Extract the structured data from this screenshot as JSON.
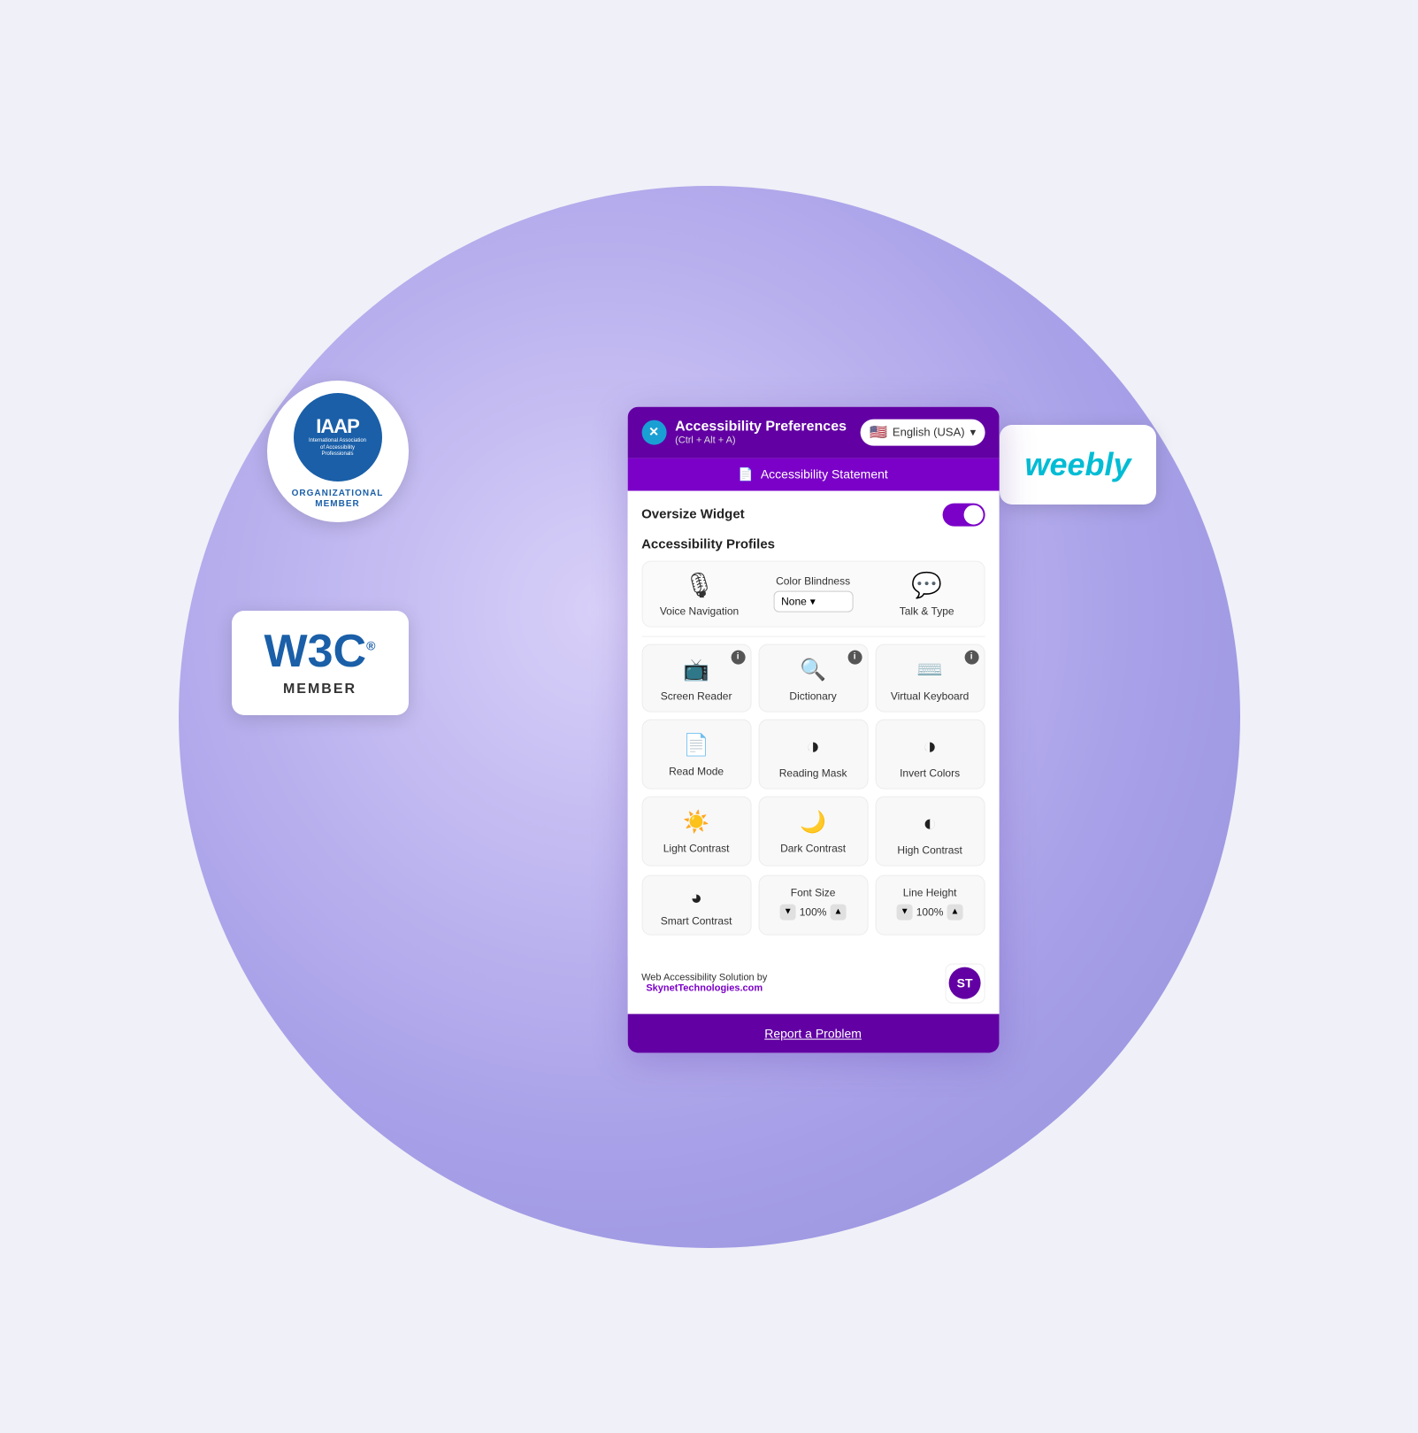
{
  "circle": {
    "visible": true
  },
  "iaap": {
    "title": "IAAP",
    "subtitle": "International Association of Accessibility Professionals",
    "org_member": "ORGANIZATIONAL\nMEMBER"
  },
  "w3c": {
    "title": "W3C",
    "member": "MEMBER"
  },
  "weebly": {
    "text": "weebly"
  },
  "header": {
    "close_label": "✕",
    "title": "Accessibility Preferences",
    "subtitle": "(Ctrl + Alt + A)",
    "lang_label": "English (USA)",
    "lang_flag": "🇺🇸"
  },
  "statement_bar": {
    "icon": "📄",
    "label": "Accessibility Statement"
  },
  "oversize_widget": {
    "label": "Oversize Widget",
    "enabled": true
  },
  "profiles": {
    "label": "Accessibility Profiles"
  },
  "top_row": {
    "voice_nav": {
      "icon": "🎙",
      "label": "Voice Navigation"
    },
    "color_blindness": {
      "title": "Color Blindness",
      "option": "None"
    },
    "talk_type": {
      "icon": "💬",
      "label": "Talk & Type"
    }
  },
  "feature_tiles": [
    {
      "icon": "📺",
      "label": "Screen Reader",
      "has_info": true
    },
    {
      "icon": "🔍",
      "label": "Dictionary",
      "has_info": true
    },
    {
      "icon": "⌨️",
      "label": "Virtual Keyboard",
      "has_info": true
    },
    {
      "icon": "📄",
      "label": "Read Mode",
      "has_info": false
    },
    {
      "icon": "🎭",
      "label": "Reading Mask",
      "has_info": false
    },
    {
      "icon": "◑",
      "label": "Invert Colors",
      "has_info": false
    },
    {
      "icon": "☀",
      "label": "Light Contrast",
      "has_info": false
    },
    {
      "icon": "🌙",
      "label": "Dark Contrast",
      "has_info": false
    },
    {
      "icon": "◐",
      "label": "High Contrast",
      "has_info": false
    }
  ],
  "bottom_row": [
    {
      "icon": "◑",
      "label": "Smart Contrast"
    },
    {
      "label": "Font Size",
      "value": "100%"
    },
    {
      "label": "Line Height",
      "value": "100%"
    }
  ],
  "footer": {
    "text": "Web Accessibility Solution by",
    "link_text": "SkynetTechnologies.com",
    "logo_text": "ST"
  },
  "report": {
    "label": "Report a Problem"
  }
}
